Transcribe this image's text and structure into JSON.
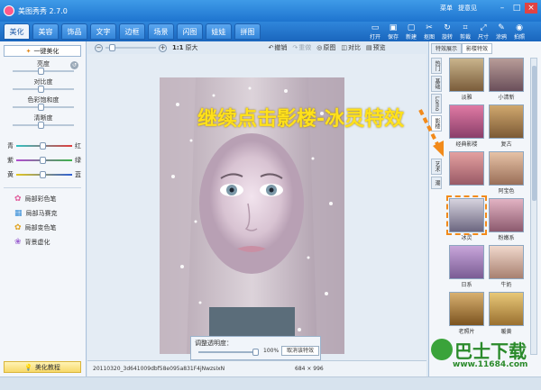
{
  "app": {
    "title": "美图秀秀 2.7.0"
  },
  "title_links": [
    "菜单",
    "提意见"
  ],
  "tabs": [
    "美化",
    "美容",
    "饰品",
    "文字",
    "边框",
    "场景",
    "闪图",
    "娃娃",
    "拼图"
  ],
  "tools": [
    {
      "label": "打开",
      "icon": "open-icon"
    },
    {
      "label": "保存",
      "icon": "save-icon"
    },
    {
      "label": "新建",
      "icon": "new-icon"
    },
    {
      "label": "抠图",
      "icon": "cutout-icon"
    },
    {
      "label": "旋转",
      "icon": "rotate-icon"
    },
    {
      "label": "剪裁",
      "icon": "crop-icon"
    },
    {
      "label": "尺寸",
      "icon": "resize-icon"
    },
    {
      "label": "涂鸦",
      "icon": "brush-icon"
    },
    {
      "label": "拍照",
      "icon": "camera-icon"
    }
  ],
  "left": {
    "onekey": "一键美化",
    "adjust": [
      "亮度",
      "对比度",
      "色彩饱和度",
      "清晰度"
    ],
    "colors": [
      {
        "left": "青",
        "right": "红"
      },
      {
        "left": "紫",
        "right": "绿"
      },
      {
        "left": "黄",
        "right": "蓝"
      }
    ],
    "tools": [
      "局部彩色笔",
      "局部马赛克",
      "局部变色笔",
      "背景虚化"
    ],
    "tutorial": "美化教程"
  },
  "toolbar": {
    "ratio": "1:1",
    "fit": "原大",
    "undo": "撤销",
    "redo": "重做",
    "original": "原图",
    "compare": "对比",
    "preview": "预览"
  },
  "headline": "继续点击影楼-冰灵特效",
  "opacity": {
    "label": "调整透明度：",
    "value": "100%",
    "cancel": "取消该特效",
    "level": 1.0
  },
  "status": {
    "filename": "20110320_3d641009dbf58e095a831F4jNwzsIxN",
    "dimensions": "684 × 996"
  },
  "right": {
    "tabs": [
      "特效展示",
      "影楼特效"
    ],
    "vtabs": [
      "热门",
      "基础",
      "Lomo",
      "影楼",
      "艺术",
      "潮"
    ],
    "thumbs": [
      "淡雅",
      "小清新",
      "经典影楼",
      "复古",
      "",
      "阿宝色",
      "冰灵",
      "粉嫩系",
      "日系",
      "牛奶",
      "老照片",
      "暖黄"
    ],
    "selected": "冰灵"
  },
  "watermark": {
    "text": "巴士下载",
    "url": "www.11684.com"
  },
  "colors": {
    "accent": "#2f86db",
    "highlight": "#f28a1a",
    "headline": "#ffe11a"
  }
}
